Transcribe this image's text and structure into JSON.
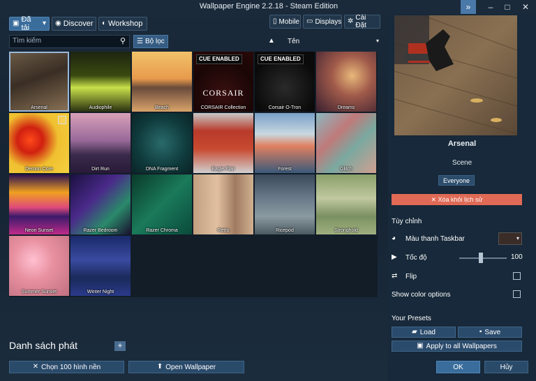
{
  "window": {
    "title": "Wallpaper Engine 2.2.18 - Steam Edition"
  },
  "topbar": {
    "installed": "Đã tải",
    "discover": "Discover",
    "workshop": "Workshop",
    "mobile": "Mobile",
    "displays": "Displays",
    "settings": "Cài Đặt"
  },
  "search": {
    "placeholder": "Tìm kiếm"
  },
  "filter": {
    "label": "Bộ lọc"
  },
  "sort": {
    "label": "Tên"
  },
  "tiles": [
    {
      "name": "Arsenal",
      "bg": "linear-gradient(160deg,#6b5b47 0%,#3a2e24 45%,#8a7256 100%)",
      "selected": true
    },
    {
      "name": "Audiophile",
      "bg": "linear-gradient(180deg,#1d2410 0%,#3a4a10 40%,#c8e04a 60%,#2a3010 100%)"
    },
    {
      "name": "Beach",
      "bg": "linear-gradient(180deg,#f1c26a 0%,#e89a4c 45%,#6a4a3a 60%,#d9a46a 100%)"
    },
    {
      "name": "CORSAIR Collection",
      "bg": "radial-gradient(circle at 50% 70%,#3a1010 0%,#1a0606 60%,#2a0808 100%)",
      "cue": "CUE ENABLED",
      "logo": "CORSAIR"
    },
    {
      "name": "Corsair O-Tron",
      "bg": "radial-gradient(circle at 50% 60%,#2a2a2a 0%,#0a0a0a 70%)",
      "cue": "CUE ENABLED"
    },
    {
      "name": "Dreams",
      "bg": "radial-gradient(circle at 60% 40%,#e8b87a 0%,#a05a4a 40%,#3a2030 100%)"
    },
    {
      "name": "Demon Core",
      "bg": "radial-gradient(circle at 35% 45%,#ff4a1a 0%,#d02010 25%,#f0c030 55%,#f4d040 100%)",
      "check": true
    },
    {
      "name": "Dirt Run",
      "bg": "linear-gradient(180deg,#d8a0b8 0%,#9a6a9a 45%,#3a2a4a 70%,#2a1a3a 100%)"
    },
    {
      "name": "DNA Fragment",
      "bg": "radial-gradient(circle at 50% 50%,#2a6a6a 0%,#0f3a3c 60%,#0a2426 100%)"
    },
    {
      "name": "Eagle Flair",
      "bg": "linear-gradient(180deg,#c8c8c8 0%,#b83a2a 30%,#c84a30 60%,#d0d0d0 100%)"
    },
    {
      "name": "Forest",
      "bg": "linear-gradient(180deg,#7aa0c8 0%,#c8d8e0 35%,#e08060 55%,#3a5a7a 100%)"
    },
    {
      "name": "Glitch",
      "bg": "linear-gradient(135deg,#8ab8c0 0%,#c07a7a 35%,#7aa8a0 60%,#d0a090 100%)"
    },
    {
      "name": "Neon Sunset",
      "bg": "linear-gradient(180deg,#2a1050 0%,#f0a020 30%,#e04a7a 55%,#3a1a6a 70%,#c02a8a 100%)"
    },
    {
      "name": "Razer Bedroom",
      "bg": "linear-gradient(135deg,#1a1040 0%,#4a2a8a 40%,#2a8a6a 70%,#1a1030 100%)"
    },
    {
      "name": "Razer Chroma",
      "bg": "linear-gradient(135deg,#0a3a2a 0%,#1a7a5a 50%,#0a4a3a 100%)"
    },
    {
      "name": "Retro",
      "bg": "linear-gradient(90deg,#c0a080 0%,#e0c0a0 40%,#a07a60 70%,#d0b090 100%)"
    },
    {
      "name": "Ricepod",
      "bg": "linear-gradient(180deg,#3a4a5a 0%,#6a7a8a 40%,#8a9aa0 70%,#4a5a60 100%)"
    },
    {
      "name": "Stronghold",
      "bg": "linear-gradient(180deg,#8aa06a 0%,#c0c8a0 40%,#7a9060 70%,#a0b080 100%)"
    },
    {
      "name": "Summer Sunset",
      "bg": "radial-gradient(circle at 40% 40%,#ffc0d0 0%,#e890a0 40%,#c07080 100%)"
    },
    {
      "name": "Winter Night",
      "bg": "linear-gradient(180deg,#1a2a6a 0%,#3a4aa0 40%,#1a2a5a 70%,#2a3a8a 100%)"
    }
  ],
  "playlist": {
    "title": "Danh sách phát",
    "add": "+"
  },
  "bottom": {
    "select_all": "Chọn 100 hình nền",
    "open": "Open Wallpaper"
  },
  "details": {
    "name": "Arsenal",
    "type": "Scene",
    "rating": "Everyone",
    "remove": "✕ Xóa khỏi lịch sử"
  },
  "customize": {
    "header": "Tùy chỉnh",
    "taskbar": "Màu thanh Taskbar",
    "speed": "Tốc độ",
    "speed_value": "100",
    "speed_level": 1.0,
    "flip": "Flip",
    "color_opts": "Show color options"
  },
  "presets": {
    "header": "Your Presets",
    "load": "Load",
    "save": "Save",
    "apply_all": "Apply to all Wallpapers"
  },
  "footer": {
    "ok": "OK",
    "cancel": "Hủy"
  },
  "colors": {
    "accent": "#3a6d9c",
    "danger": "#e06a55",
    "panel": "#17293a"
  }
}
